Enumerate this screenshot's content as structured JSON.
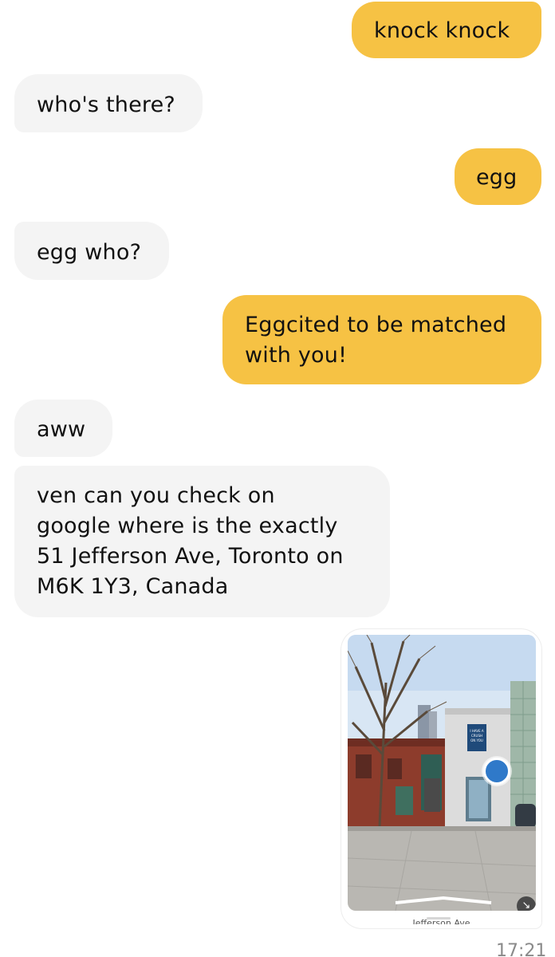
{
  "messages": [
    {
      "direction": "sent",
      "text": "knock knock"
    },
    {
      "direction": "received",
      "text": "who's there?"
    },
    {
      "direction": "sent",
      "text": "egg"
    },
    {
      "direction": "received",
      "text": "egg who?"
    },
    {
      "direction": "sent",
      "line1": "Eggcited to be matched",
      "line2": "with you!"
    },
    {
      "direction": "received",
      "text": "aww"
    },
    {
      "direction": "received",
      "line1": "ven can you check on",
      "line2": "google where is the exactly",
      "line3": "51 Jefferson Ave, Toronto on",
      "line4": "M6K 1Y3, Canada"
    }
  ],
  "photo_message": {
    "sign_text": "I HAVE A CRUSH ON YOU",
    "caption": "Jefferson Ave",
    "icons": [
      "location-pin-icon",
      "collapse-icon"
    ]
  },
  "timestamp": "17:21",
  "colors": {
    "sent_bubble": "#f6c244",
    "received_bubble": "#f4f4f4",
    "text": "#111111",
    "map_pin": "#2f79c9"
  }
}
